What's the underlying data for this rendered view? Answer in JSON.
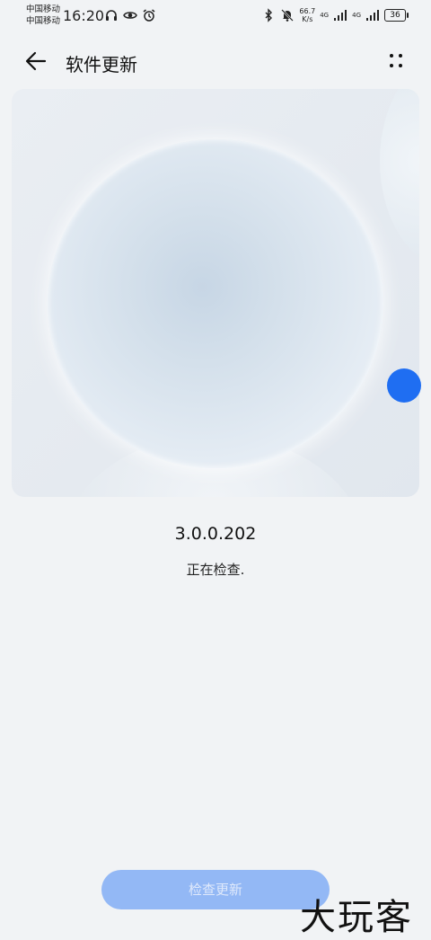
{
  "status_bar": {
    "carrier_1": "中国移动",
    "carrier_2": "中国移动",
    "time": "16:20",
    "speed_value": "66.7",
    "speed_unit": "K/s",
    "net_1": "4G",
    "net_2": "4G",
    "battery": "36"
  },
  "header": {
    "title": "软件更新"
  },
  "main": {
    "version": "3.0.0.202",
    "status_text": "正在检查."
  },
  "footer": {
    "check_button_label": "检查更新"
  },
  "watermark": "大玩客",
  "colors": {
    "accent": "#1f6ef2",
    "button_disabled": "#93b8f5",
    "background": "#f1f3f5"
  }
}
